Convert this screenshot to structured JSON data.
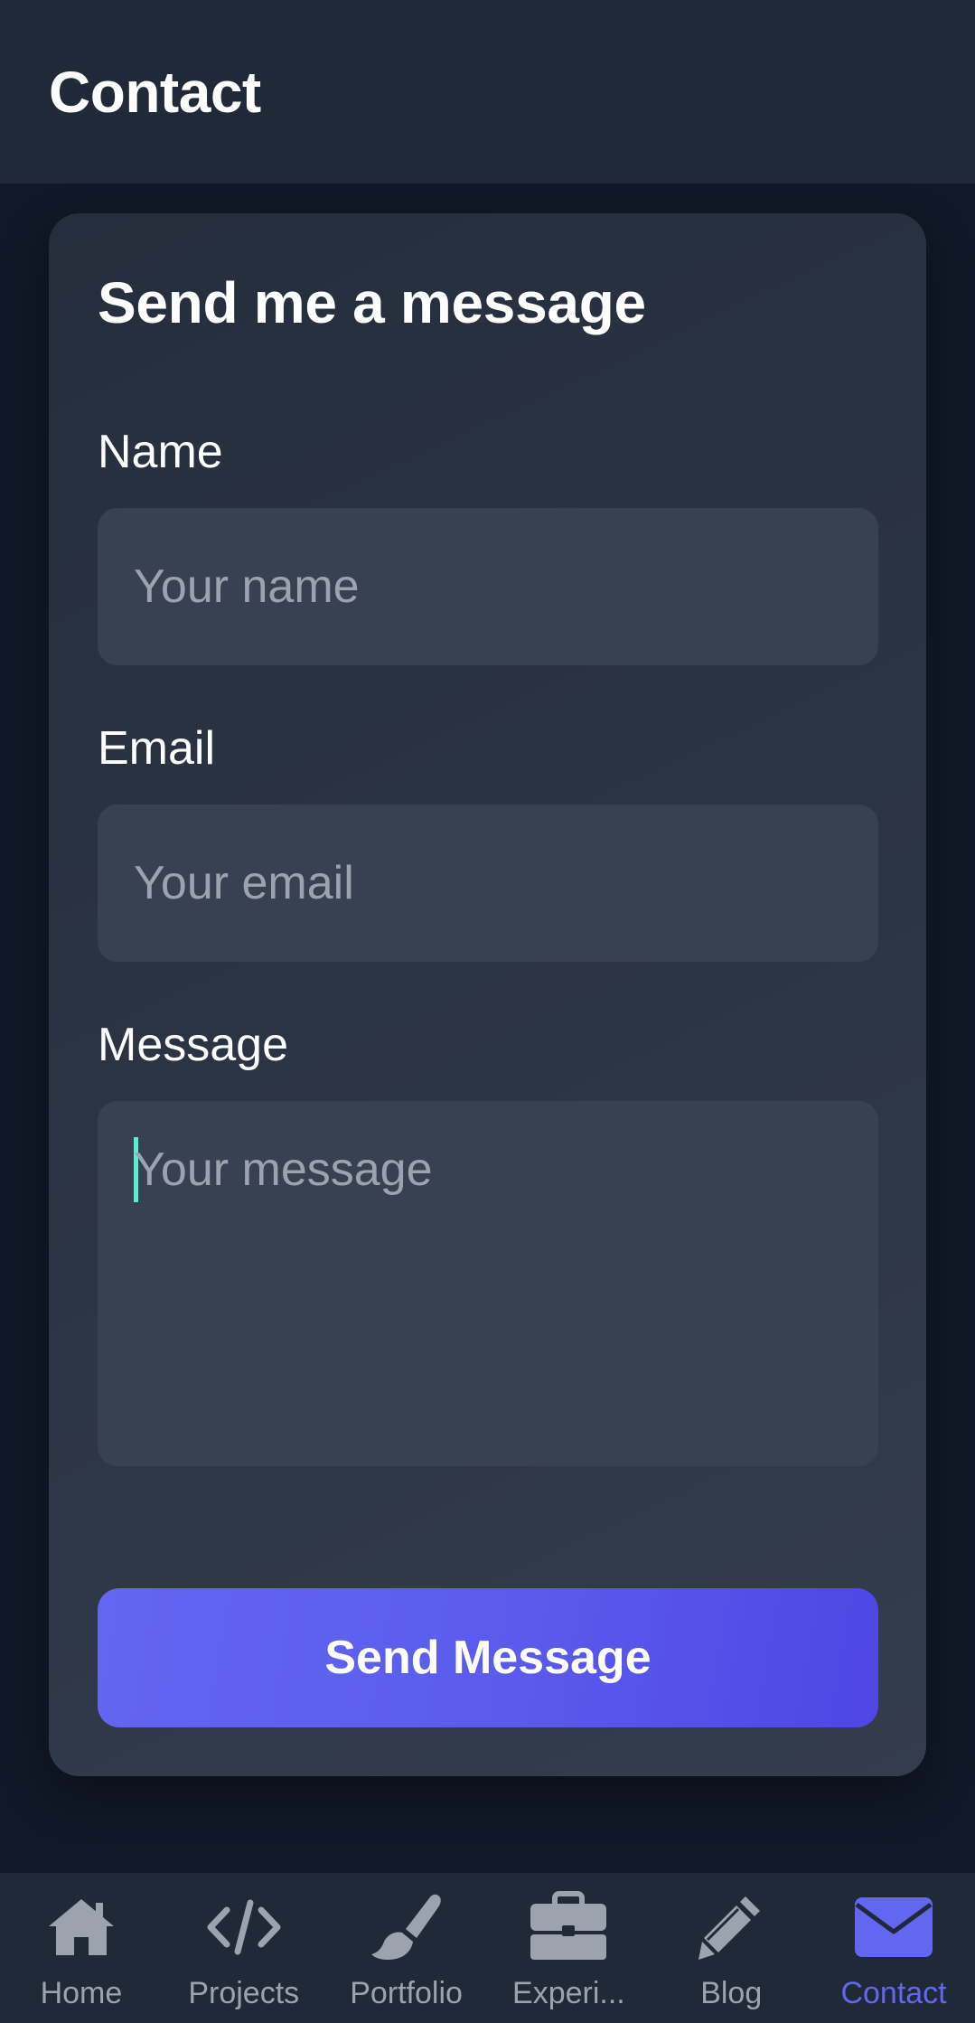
{
  "header": {
    "title": "Contact"
  },
  "form": {
    "title": "Send me a message",
    "name_label": "Name",
    "name_placeholder": "Your name",
    "email_label": "Email",
    "email_placeholder": "Your email",
    "message_label": "Message",
    "message_placeholder": "Your message",
    "submit_label": "Send Message"
  },
  "nav": {
    "items": [
      {
        "label": "Home",
        "icon": "home-icon"
      },
      {
        "label": "Projects",
        "icon": "code-icon"
      },
      {
        "label": "Portfolio",
        "icon": "paintbrush-icon"
      },
      {
        "label": "Experi...",
        "icon": "briefcase-icon"
      },
      {
        "label": "Blog",
        "icon": "pencil-icon"
      },
      {
        "label": "Contact",
        "icon": "envelope-icon",
        "active": true
      }
    ]
  },
  "colors": {
    "background": "#111827",
    "header": "#1f2937",
    "input": "#374151",
    "accent": "#6366f1",
    "caret": "#5eead4",
    "nav_inactive": "#9ca3af"
  }
}
